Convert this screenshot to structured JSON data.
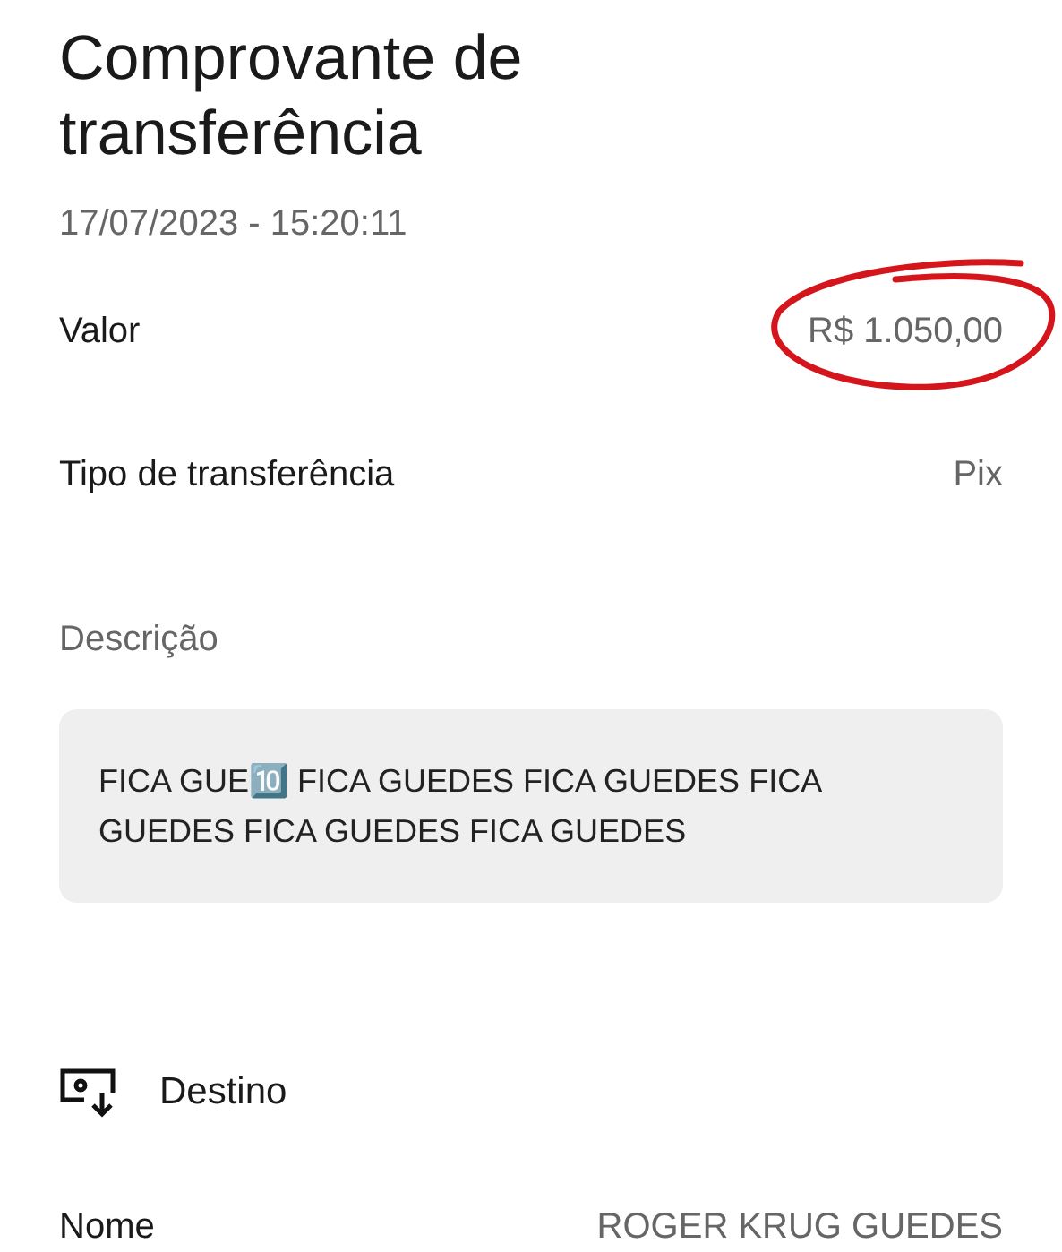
{
  "title": "Comprovante de transferência",
  "datetime": "17/07/2023 - 15:20:11",
  "rows": [
    {
      "label": "Valor",
      "value": "R$ 1.050,00",
      "circled": true
    },
    {
      "label": "Tipo de transferência",
      "value": "Pix",
      "circled": false
    }
  ],
  "description": {
    "label": "Descrição",
    "text": "FICA GUE🔟 FICA GUEDES FICA GUEDES FICA GUEDES FICA GUEDES FICA GUEDES"
  },
  "section": {
    "title": "Destino"
  },
  "recipient_rows": [
    {
      "label": "Nome",
      "value": "ROGER KRUG GUEDES"
    }
  ]
}
